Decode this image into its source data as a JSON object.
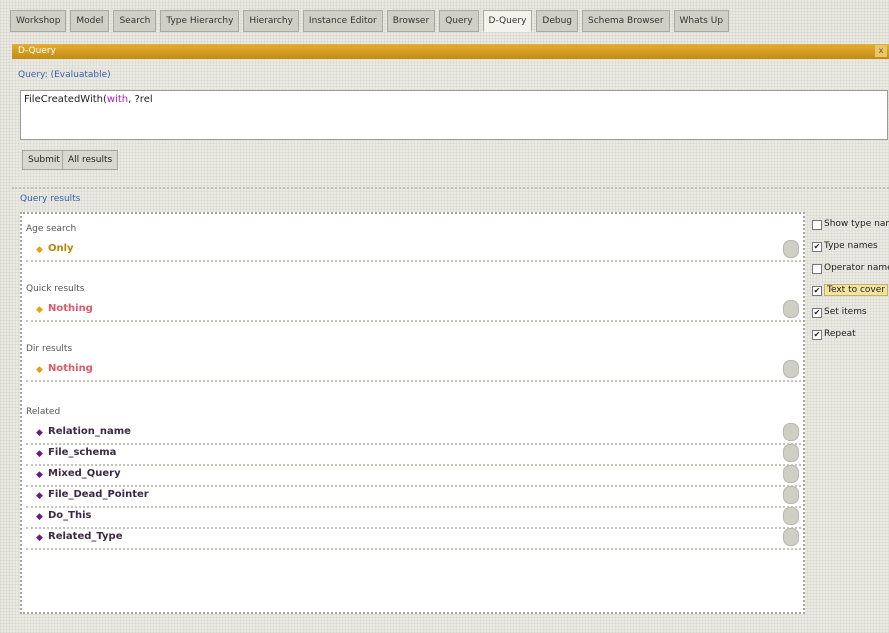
{
  "tabs": [
    {
      "label": "Workshop",
      "active": false
    },
    {
      "label": "Model",
      "active": false
    },
    {
      "label": "Search",
      "active": false
    },
    {
      "label": "Type Hierarchy",
      "active": false
    },
    {
      "label": "Hierarchy",
      "active": false
    },
    {
      "label": "Instance Editor",
      "active": false
    },
    {
      "label": "Browser",
      "active": false
    },
    {
      "label": "Query",
      "active": false
    },
    {
      "label": "D-Query",
      "active": true
    },
    {
      "label": "Debug",
      "active": false
    },
    {
      "label": "Schema Browser",
      "active": false
    },
    {
      "label": "Whats Up",
      "active": false
    }
  ],
  "panel": {
    "title": "D-Query",
    "close_label": "x"
  },
  "query": {
    "link": "Query: (Evaluatable)",
    "prefix": "FileCreatedWith(",
    "fn": "with",
    "suffix": ", ?rel"
  },
  "buttons": {
    "submit": "Submit",
    "results": "All results"
  },
  "results": {
    "link": "Query results",
    "groups": [
      {
        "label": "Age search",
        "items": [
          {
            "name": "Only",
            "glyph_color": "#e3a115",
            "text_color": "#b8860b"
          }
        ]
      },
      {
        "label": "Quick results",
        "items": [
          {
            "name": "Nothing",
            "glyph_color": "#e3a115",
            "text_color": "#e05a6a"
          }
        ]
      },
      {
        "label": "Dir results",
        "items": [
          {
            "name": "Nothing",
            "glyph_color": "#e3a115",
            "text_color": "#e05a6a"
          }
        ]
      },
      {
        "label": "Related",
        "items": [
          {
            "name": "Relation_name",
            "glyph_color": "#6a1a7a",
            "text_color": "#3a2a44"
          },
          {
            "name": "File_schema",
            "glyph_color": "#6a1a7a",
            "text_color": "#3a2a44"
          },
          {
            "name": "Mixed_Query",
            "glyph_color": "#6a1a7a",
            "text_color": "#3a2a44"
          },
          {
            "name": "File_Dead_Pointer",
            "glyph_color": "#6a1a7a",
            "text_color": "#3a2a44"
          },
          {
            "name": "Do_This",
            "glyph_color": "#6a1a7a",
            "text_color": "#3a2a44"
          },
          {
            "name": "Related_Type",
            "glyph_color": "#6a1a7a",
            "text_color": "#3a2a44"
          }
        ]
      }
    ]
  },
  "options": [
    {
      "label": "Show type names",
      "checked": false,
      "highlight": false
    },
    {
      "label": "Type names",
      "checked": true,
      "highlight": false
    },
    {
      "label": "Operator names",
      "checked": false,
      "highlight": false
    },
    {
      "label": "Text to cover",
      "checked": true,
      "highlight": true
    },
    {
      "label": "Set items",
      "checked": true,
      "highlight": false
    },
    {
      "label": "Repeat",
      "checked": true,
      "highlight": false
    }
  ],
  "colors": {
    "title_bar": "#d49d1f",
    "link": "#3a5fb0",
    "query_fn": "#b020c0"
  },
  "icons": {
    "result_glyph": "arrow-tag-icon",
    "row_action": "circle-knob-icon",
    "close": "close-icon"
  }
}
